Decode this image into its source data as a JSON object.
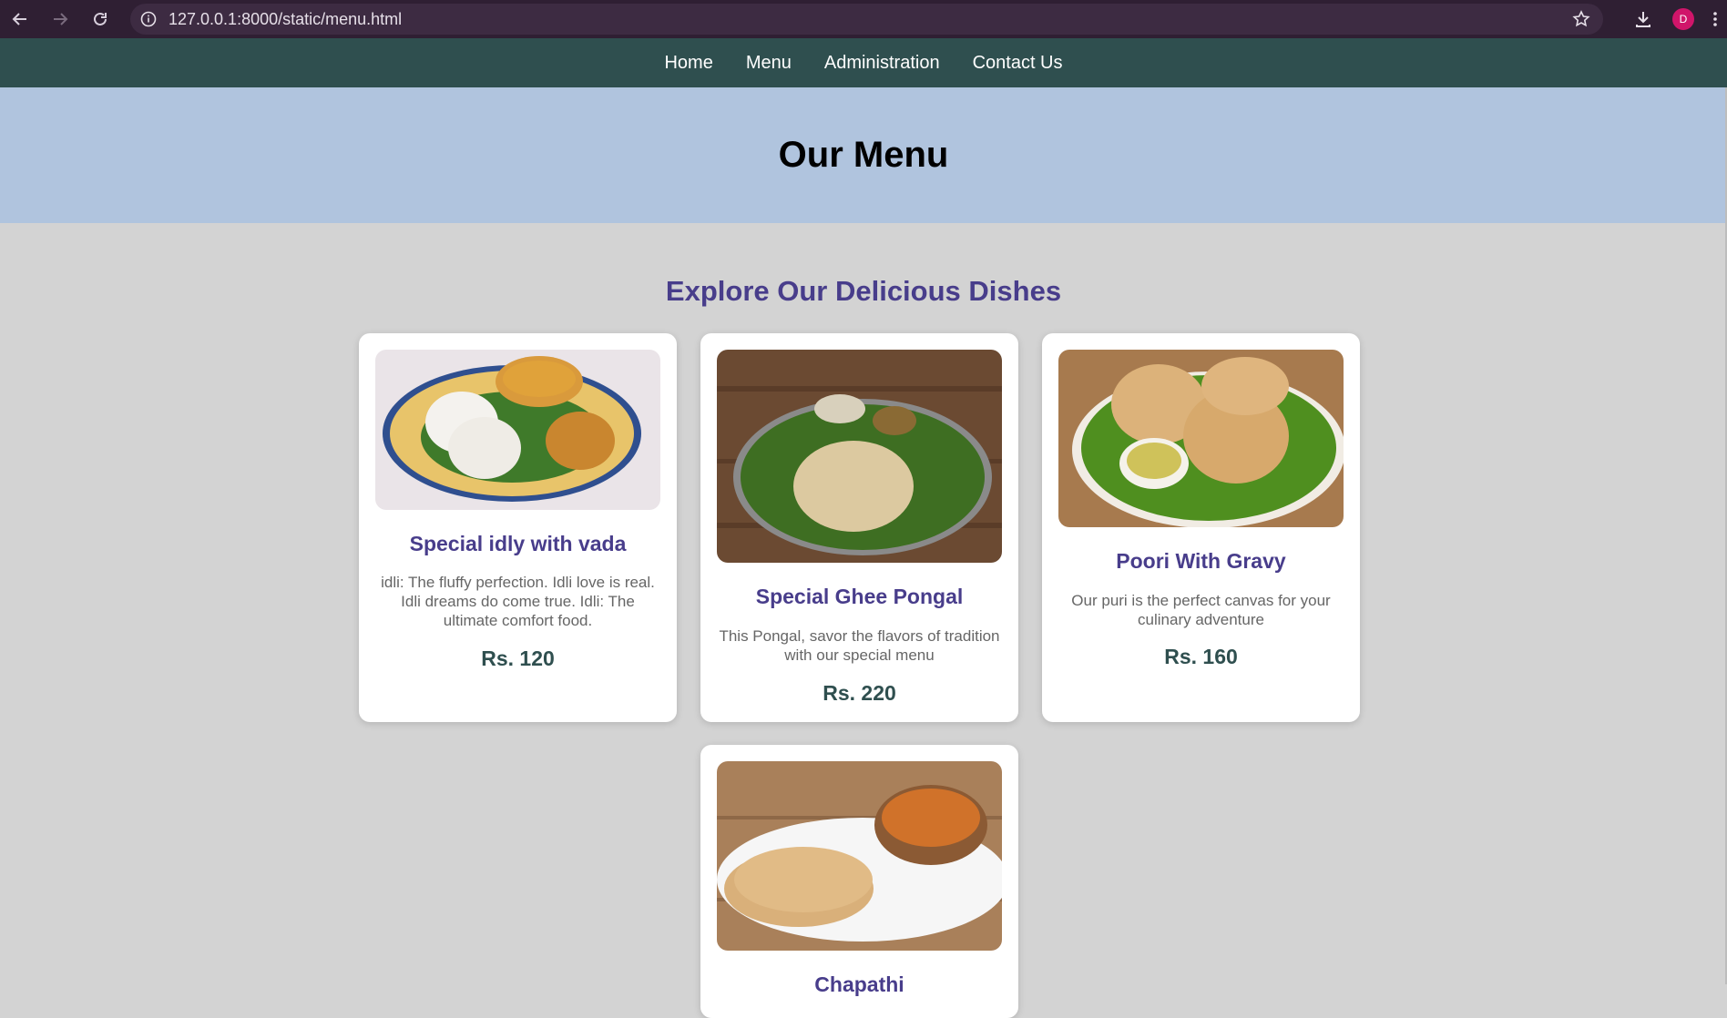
{
  "browser": {
    "url": "127.0.0.1:8000/static/menu.html",
    "profile_initial": "D",
    "accent": "#d0156a"
  },
  "nav": {
    "items": [
      "Home",
      "Menu",
      "Administration",
      "Contact Us"
    ]
  },
  "hero": {
    "title": "Our Menu"
  },
  "section": {
    "title": "Explore Our Delicious Dishes"
  },
  "dishes": [
    {
      "name": "Special idly with vada",
      "description": "idli: The fluffy perfection. Idli love is real. Idli dreams do come true. Idli: The ultimate comfort food.",
      "price": "Rs. 120",
      "image": "idly-vada-photo"
    },
    {
      "name": "Special Ghee Pongal",
      "description": "This Pongal, savor the flavors of tradition with our special menu",
      "price": "Rs. 220",
      "image": "pongal-photo"
    },
    {
      "name": "Poori With Gravy",
      "description": "Our puri is the perfect canvas for your culinary adventure",
      "price": "Rs. 160",
      "image": "poori-photo"
    },
    {
      "name": "Chapathi",
      "description": "",
      "price": "",
      "image": "chapathi-photo"
    }
  ],
  "colors": {
    "nav_bg": "#2f4f4f",
    "hero_bg": "#b0c4de",
    "heading": "#483d8b",
    "page_bg": "#d3d3d3"
  }
}
